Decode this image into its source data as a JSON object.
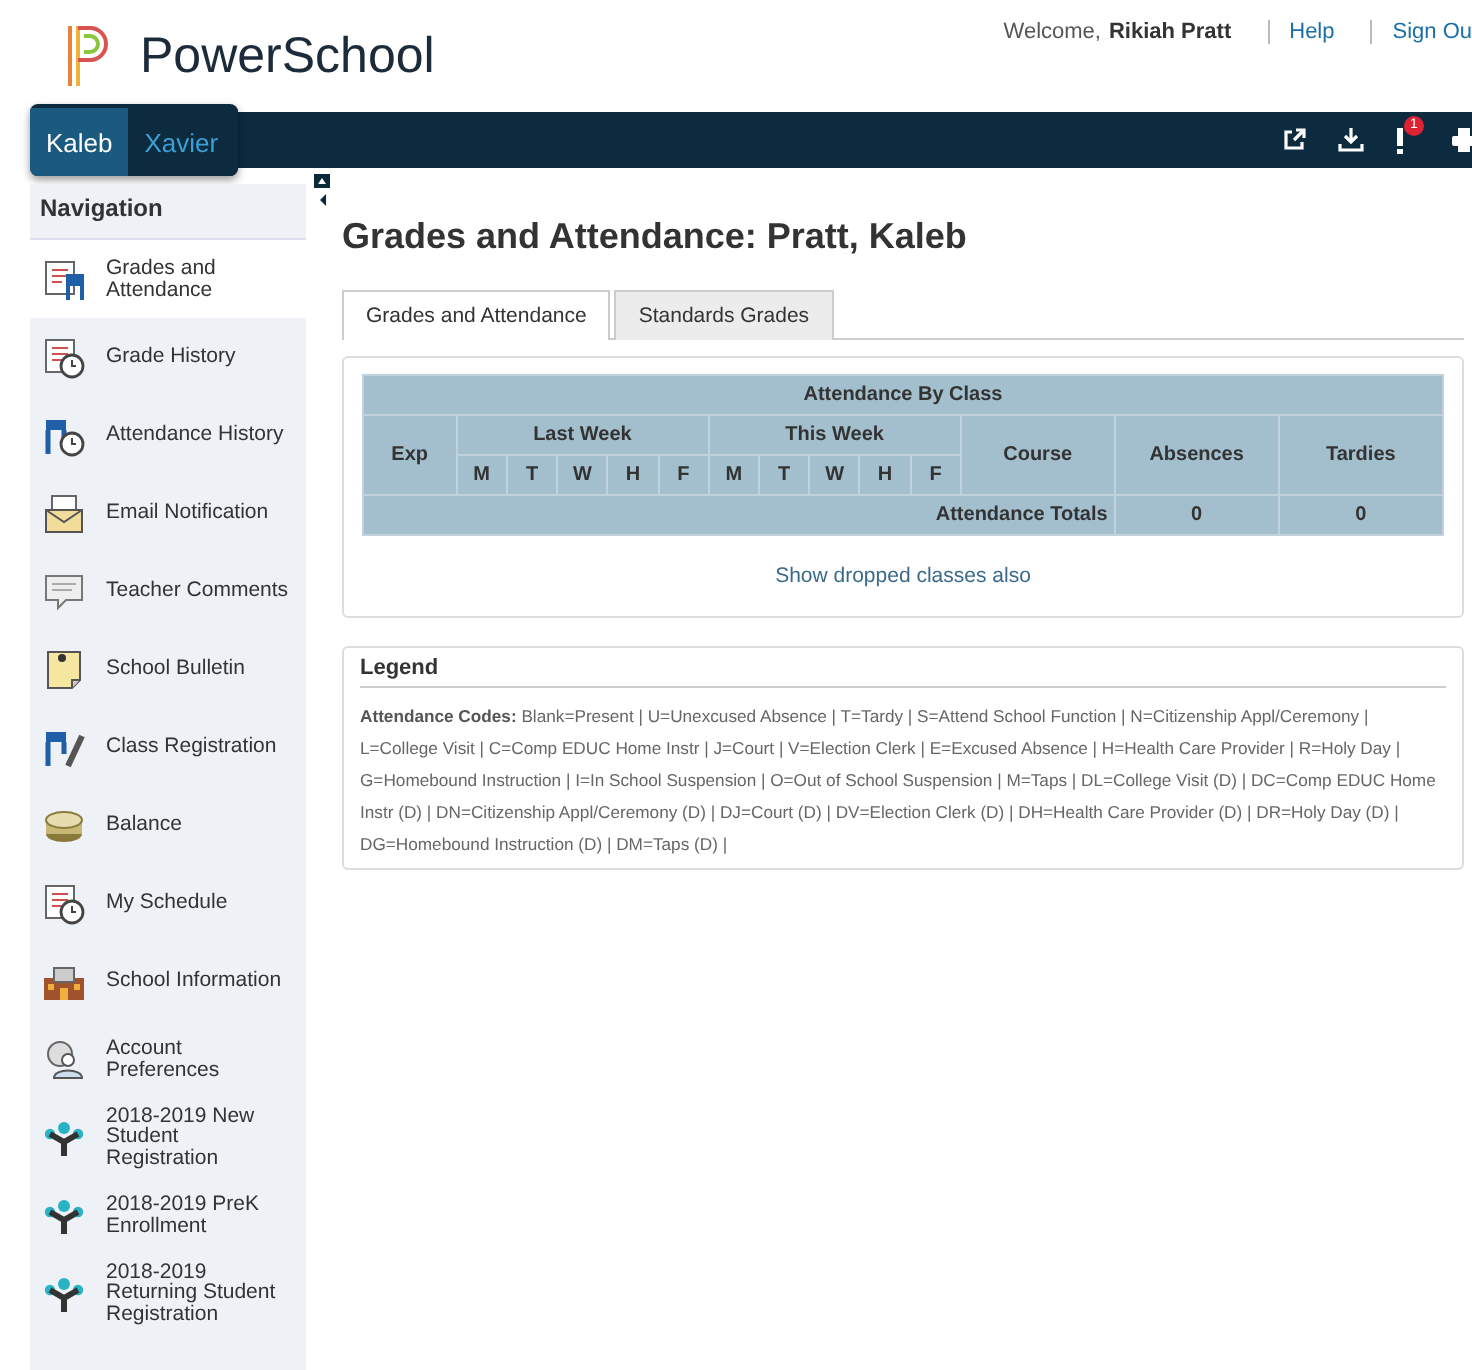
{
  "header": {
    "logo_text": "PowerSchool",
    "welcome_label": "Welcome,",
    "user_name": "Rikiah Pratt",
    "links": [
      "Help",
      "Sign Ou"
    ]
  },
  "students": [
    {
      "name": "Kaleb",
      "selected": true
    },
    {
      "name": "Xavier",
      "selected": false
    }
  ],
  "toolbar": {
    "alert_badge": "1"
  },
  "sidebar": {
    "title": "Navigation",
    "items": [
      {
        "label": "Grades and Attendance",
        "selected": true
      },
      {
        "label": "Grade History",
        "selected": false
      },
      {
        "label": "Attendance History",
        "selected": false
      },
      {
        "label": "Email Notification",
        "selected": false
      },
      {
        "label": "Teacher Comments",
        "selected": false
      },
      {
        "label": "School Bulletin",
        "selected": false
      },
      {
        "label": "Class Registration",
        "selected": false
      },
      {
        "label": "Balance",
        "selected": false
      },
      {
        "label": "My Schedule",
        "selected": false
      },
      {
        "label": "School Information",
        "selected": false
      },
      {
        "label": "Account Preferences",
        "selected": false
      },
      {
        "label": "2018-2019 New Student Registration",
        "selected": false
      },
      {
        "label": "2018-2019 PreK Enrollment",
        "selected": false
      },
      {
        "label": "2018-2019 Returning Student Registration",
        "selected": false
      }
    ]
  },
  "page_title": "Grades and Attendance: Pratt, Kaleb",
  "tabs": [
    {
      "label": "Grades and Attendance",
      "selected": true
    },
    {
      "label": "Standards Grades",
      "selected": false
    }
  ],
  "table": {
    "title": "Attendance By Class",
    "exp_header": "Exp",
    "last_week_header": "Last Week",
    "this_week_header": "This Week",
    "last_week_days": [
      "M",
      "T",
      "W",
      "H",
      "F"
    ],
    "this_week_days": [
      "M",
      "T",
      "W",
      "H",
      "F"
    ],
    "course_header": "Course",
    "absences_header": "Absences",
    "tardies_header": "Tardies",
    "totals_label": "Attendance Totals",
    "absences_total": "0",
    "tardies_total": "0"
  },
  "dropped_link": "Show dropped classes also",
  "legend": {
    "title": "Legend",
    "text": "**Attendance Codes:**  Blank=Present | U=Unexcused Absence | T=Tardy | S=Attend School Function | N=Citizenship Appl/Ceremony | L=College Visit | C=Comp EDUC Home Instr | J=Court | V=Election Clerk | E=Excused Absence | H=Health Care Provider | R=Holy Day | G=Homebound Instruction | I=In School Suspension | O=Out of School Suspension | M=Taps | DL=College Visit (D) | DC=Comp EDUC Home Instr (D) | DN=Citizenship Appl/Ceremony (D) | DJ=Court (D) | DV=Election Clerk (D) | DH=Health Care Provider (D) | DR=Holy Day (D) | DG=Homebound Instruction (D) | DM=Taps (D) |"
  }
}
